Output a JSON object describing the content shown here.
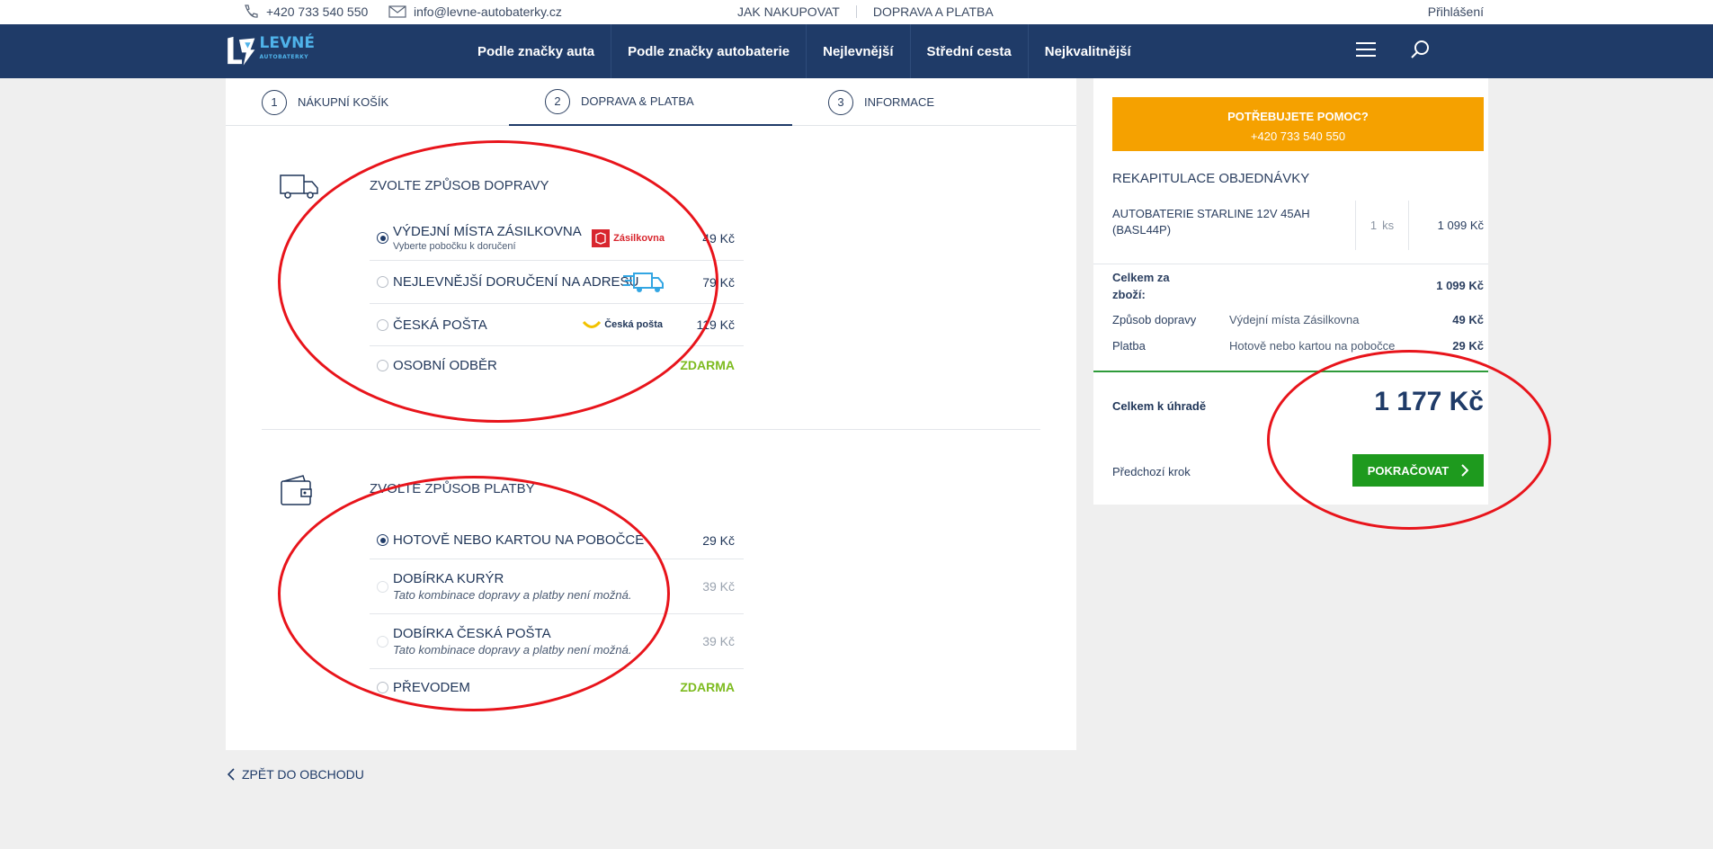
{
  "topbar": {
    "phone": "+420 733 540 550",
    "email": "info@levne-autobaterky.cz",
    "links": [
      "JAK NAKUPOVAT",
      "DOPRAVA A PLATBA"
    ],
    "login": "Přihlášení"
  },
  "logo": {
    "word": "LEVNÉ",
    "sub": "AUTOBATERKY"
  },
  "nav": {
    "items": [
      "Podle značky auta",
      "Podle značky autobaterie",
      "Nejlevnější",
      "Střední cesta",
      "Nejkvalitnější"
    ]
  },
  "steps": [
    {
      "num": "1",
      "label": "Nákupní košík"
    },
    {
      "num": "2",
      "label": "Doprava & platba"
    },
    {
      "num": "3",
      "label": "Informace"
    }
  ],
  "shipping": {
    "title": "Zvolte způsob dopravy",
    "options": [
      {
        "name": "Výdejní místa Zásilkovna",
        "sub": "Vyberte pobočku k doručení",
        "logo": "Zásilkovna",
        "price": "49 Kč",
        "selected": true
      },
      {
        "name": "Nejlevnější doručení na adresu",
        "sub": "",
        "logo": "",
        "price": "79 Kč",
        "selected": false
      },
      {
        "name": "Česká pošta",
        "sub": "",
        "logo": "Česká pošta",
        "price": "119 Kč",
        "selected": false
      },
      {
        "name": "Osobní odběr",
        "sub": "",
        "logo": "",
        "price": "Zdarma",
        "selected": false
      }
    ]
  },
  "payment": {
    "title": "Zvolte způsob platby",
    "options": [
      {
        "name": "Hotově nebo kartou na pobočce",
        "sub": "",
        "price": "29 Kč",
        "selected": true
      },
      {
        "name": "Dobírka kurýr",
        "sub": "Tato kombinace dopravy a platby není možná.",
        "price": "39 Kč",
        "selected": false
      },
      {
        "name": "Dobírka Česká pošta",
        "sub": "Tato kombinace dopravy a platby není možná.",
        "price": "39 Kč",
        "selected": false
      },
      {
        "name": "Převodem",
        "sub": "",
        "price": "Zdarma",
        "selected": false
      }
    ]
  },
  "back_link": "Zpět do obchodu",
  "sidebar": {
    "help_title": "Potřebujete pomoc?",
    "help_phone": "+420 733 540 550",
    "recap_title": "Rekapitulace objednávky",
    "item_name": "Autobaterie STARLINE 12V 45AH (BASL44P)",
    "item_qty": "1",
    "item_unit": "ks",
    "item_price": "1 099 Kč",
    "goods_label": "Celkem za zboží:",
    "goods_value": "1 099 Kč",
    "ship_label": "Způsob dopravy",
    "ship_name": "Výdejní místa Zásilkovna",
    "ship_price": "49 Kč",
    "pay_label": "Platba",
    "pay_name": "Hotově nebo kartou na pobočce",
    "pay_price": "29 Kč",
    "total_label": "Celkem k úhradě",
    "total_value": "1 177 Kč",
    "prev_step": "Předchozí krok",
    "continue": "Pokračovat"
  },
  "colors": {
    "navy": "#1f3b68",
    "orange": "#f5a100",
    "green": "#1e9a1e",
    "free": "#7dbb1f",
    "annotation": "#e8141b"
  }
}
